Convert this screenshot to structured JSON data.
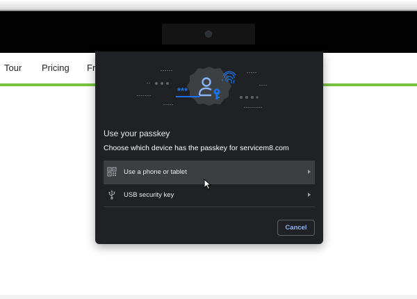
{
  "site_nav": {
    "items": [
      {
        "label": "Tour"
      },
      {
        "label": "Pricing"
      },
      {
        "label": "Fr"
      }
    ],
    "accent_color": "#7ac142"
  },
  "dialog": {
    "title": "Use your passkey",
    "subtitle": "Choose which device has the passkey for servicem8.com",
    "illustration": {
      "password_mask": "***",
      "icons": [
        "passkey-user-key-icon",
        "fingerprint-icon"
      ]
    },
    "options": [
      {
        "label": "Use a phone or tablet",
        "icon": "qr-code-icon",
        "highlighted": true
      },
      {
        "label": "USB security key",
        "icon": "usb-icon",
        "highlighted": false
      }
    ],
    "cancel_label": "Cancel",
    "accent_color": "#8ab4f8"
  }
}
